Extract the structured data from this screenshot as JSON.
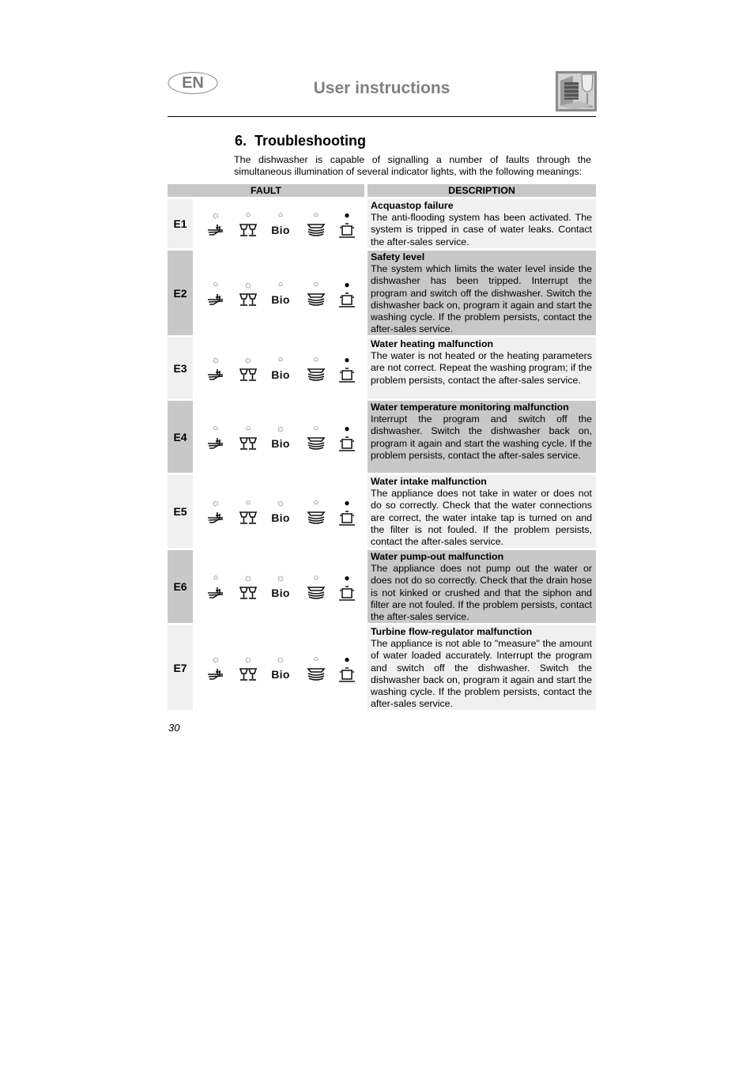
{
  "header": {
    "language_badge": "EN",
    "title": "User instructions",
    "logo_icon": "dishwasher-glass-logo-icon"
  },
  "section": {
    "number": "6.",
    "title": "Troubleshooting",
    "intro": "The dishwasher is capable of signalling a number of faults through the simultaneous illumination of several indicator lights, with the following meanings:"
  },
  "table": {
    "headers": {
      "fault": "FAULT",
      "description": "DESCRIPTION"
    },
    "indicator_symbols": [
      {
        "name": "intensive-wash-icon",
        "label": ""
      },
      {
        "name": "glasses-icon",
        "label": ""
      },
      {
        "name": "bio-label",
        "label": "Bio"
      },
      {
        "name": "plates-icon",
        "label": ""
      },
      {
        "name": "pot-icon",
        "label": ""
      }
    ],
    "lamp_legend": {
      "flashing": "☼",
      "off": "○",
      "on": "●"
    },
    "rows": [
      {
        "code": "E1",
        "lights": [
          "flashing",
          "off",
          "off",
          "off",
          "on"
        ],
        "title": "Acquastop failure",
        "text": "The anti-flooding system has been activated. The system is tripped in case of water leaks. Contact the after-sales service."
      },
      {
        "code": "E2",
        "lights": [
          "off",
          "flashing",
          "off",
          "off",
          "on"
        ],
        "title": "Safety level",
        "text": "The system which limits the water level inside the dishwasher has been tripped. Interrupt the program and switch off the dishwasher. Switch the dishwasher back on, program it again and start the washing cycle. If the problem persists, contact the after-sales service."
      },
      {
        "code": "E3",
        "lights": [
          "flashing",
          "flashing",
          "off",
          "off",
          "on"
        ],
        "title": "Water heating malfunction",
        "text": "The water is not heated or the heating parameters are not correct. Repeat the washing program; if the problem persists, contact the after-sales service."
      },
      {
        "code": "E4",
        "lights": [
          "off",
          "off",
          "flashing",
          "off",
          "on"
        ],
        "title": "Water temperature monitoring malfunction",
        "text": "Interrupt the program and switch off the dishwasher. Switch the dishwasher back on, program it again and start the washing cycle. If the problem persists, contact the after-sales service."
      },
      {
        "code": "E5",
        "lights": [
          "flashing",
          "off",
          "flashing",
          "off",
          "on"
        ],
        "title": "Water intake malfunction",
        "text": "The appliance does not take in water or does not do so correctly. Check that the water connections are correct, the water intake tap is turned on and the filter is not fouled. If the problem persists, contact the after-sales service."
      },
      {
        "code": "E6",
        "lights": [
          "off",
          "flashing",
          "flashing",
          "off",
          "on"
        ],
        "title": "Water pump-out malfunction",
        "text": "The appliance does not pump out the water or does not do so correctly. Check that the drain hose is not kinked or crushed and that the siphon and filter are not fouled. If the problem persists, contact the after-sales service."
      },
      {
        "code": "E7",
        "lights": [
          "flashing",
          "flashing",
          "flashing",
          "off",
          "on"
        ],
        "title": "Turbine flow-regulator malfunction",
        "text": "The appliance is not able to \"measure\" the amount of water loaded accurately. Interrupt the program and switch off the dishwasher. Switch the dishwasher back on, program it again and start the washing cycle. If the problem persists, contact the after-sales service."
      }
    ]
  },
  "footer": {
    "page_number": "30"
  }
}
